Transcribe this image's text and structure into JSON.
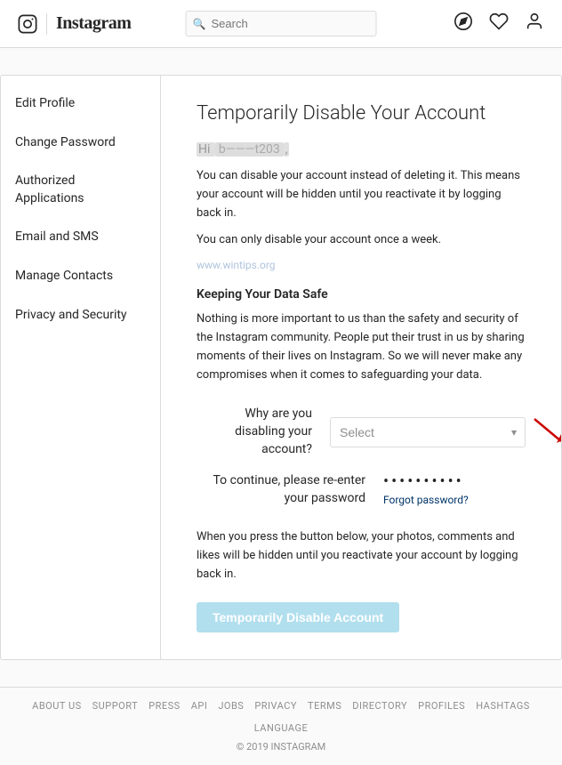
{
  "header": {
    "logo": "Instagram",
    "search_placeholder": "Search",
    "icons": [
      "compass-icon",
      "heart-icon",
      "user-icon"
    ]
  },
  "sidebar": {
    "items": [
      {
        "label": "Edit Profile",
        "active": false
      },
      {
        "label": "Change Password",
        "active": false
      },
      {
        "label": "Authorized Applications",
        "active": false
      },
      {
        "label": "Email and SMS",
        "active": false
      },
      {
        "label": "Manage Contacts",
        "active": false
      },
      {
        "label": "Privacy and Security",
        "active": false
      }
    ]
  },
  "content": {
    "title": "Temporarily Disable Your Account",
    "greeting_prefix": "Hi ",
    "username_redacted": "b———t203",
    "greeting_suffix": ",",
    "paragraph1": "You can disable your account instead of deleting it. This means your account will be hidden until you reactivate it by logging back in.",
    "paragraph2": "You can only disable your account once a week.",
    "watermark": "www.wintips.org",
    "section_title": "Keeping Your Data Safe",
    "section_body": "Nothing is more important to us than the safety and security of the Instagram community. People put their trust in us by sharing moments of their lives on Instagram. So we will never make any compromises when it comes to safeguarding your data.",
    "form": {
      "reason_label": "Why are you disabling your account?",
      "reason_placeholder": "Select",
      "password_label": "To continue, please re-enter your password",
      "password_value": "••••••••••",
      "forgot_link": "Forgot password?"
    },
    "bottom_text": "When you press the button below, your photos, comments and likes will be hidden until you reactivate your account by logging back in.",
    "disable_button": "Temporarily Disable Account"
  },
  "footer": {
    "links": [
      "ABOUT US",
      "SUPPORT",
      "PRESS",
      "API",
      "JOBS",
      "PRIVACY",
      "TERMS",
      "DIRECTORY",
      "PROFILES",
      "HASHTAGS",
      "LANGUAGE"
    ],
    "copyright": "© 2019 INSTAGRAM"
  }
}
